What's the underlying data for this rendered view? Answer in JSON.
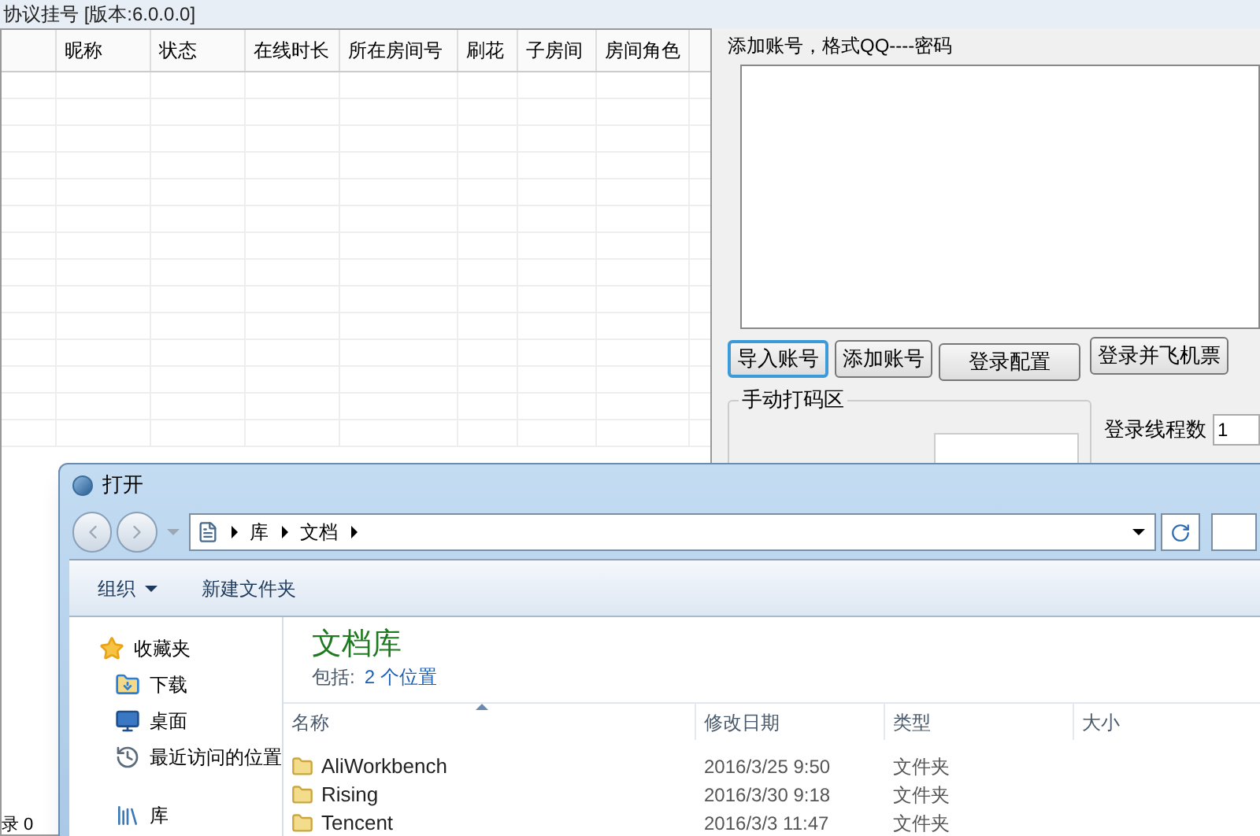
{
  "main_window": {
    "title": "协议挂号 [版本:6.0.0.0]",
    "table": {
      "columns": [
        "昵称",
        "状态",
        "在线时长",
        "所在房间号",
        "刷花",
        "子房间",
        "房间角色"
      ]
    },
    "account_label": "添加账号，格式QQ----密码",
    "buttons": [
      {
        "label": "导入账号",
        "focused": true
      },
      {
        "label": "添加账号",
        "focused": false
      },
      {
        "label": "登录配置",
        "focused": false
      },
      {
        "label": "登录并飞机票",
        "focused": false
      }
    ],
    "captcha_group": {
      "title": "手动打码区"
    },
    "thread_label": "登录线程数",
    "thread_value": "1",
    "status_text": "录 0"
  },
  "open_dialog": {
    "title": "打开",
    "breadcrumb": [
      "库",
      "文档"
    ],
    "toolbar": [
      {
        "label": "组织",
        "kind": "menu"
      },
      {
        "label": "新建文件夹",
        "kind": "button"
      }
    ],
    "nav": [
      {
        "label": "收藏夹",
        "kind": "favorites"
      },
      {
        "label": "下载",
        "kind": "downloads"
      },
      {
        "label": "桌面",
        "kind": "desktop"
      },
      {
        "label": "最近访问的位置",
        "kind": "recent"
      },
      {
        "label": "库",
        "kind": "library"
      }
    ],
    "library_title": "文档库",
    "includes_label": "包括:",
    "includes_link": "2 个位置",
    "columns": [
      "名称",
      "修改日期",
      "类型",
      "大小"
    ],
    "files": [
      {
        "name": "AliWorkbench",
        "modified": "2016/3/25 9:50",
        "type": "文件夹"
      },
      {
        "name": "Rising",
        "modified": "2016/3/30 9:18",
        "type": "文件夹"
      },
      {
        "name": "Tencent",
        "modified": "2016/3/3 11:47",
        "type": "文件夹"
      }
    ]
  }
}
